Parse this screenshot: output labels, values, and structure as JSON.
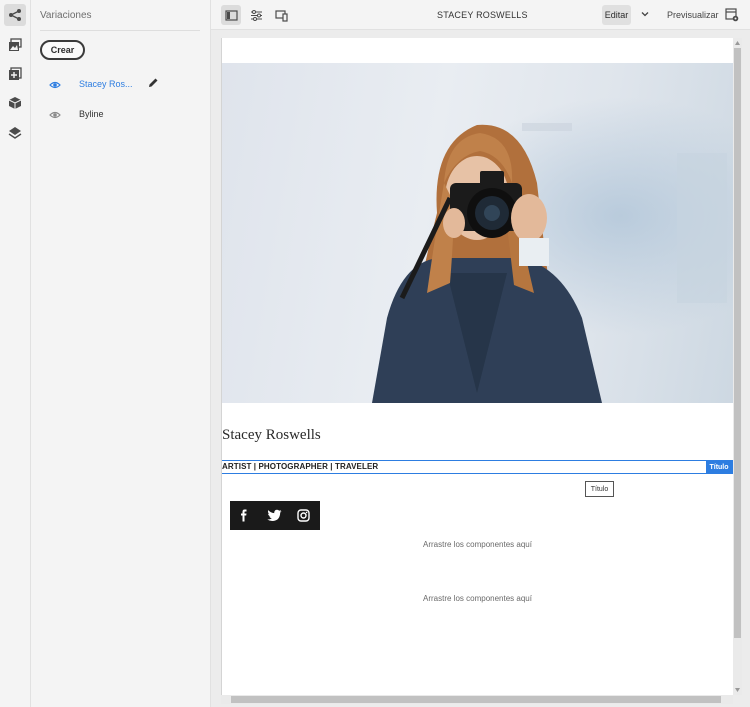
{
  "rail": {
    "items": [
      "share-variations-icon",
      "assets-icon",
      "add-component-icon",
      "content-fragment-icon",
      "layers-icon"
    ]
  },
  "panel": {
    "title": "Variaciones",
    "create_label": "Crear",
    "variations": [
      {
        "label": "Stacey Ros...",
        "active": true
      },
      {
        "label": "Byline",
        "active": false
      }
    ]
  },
  "topbar": {
    "doc_title": "STACEY ROSWELLS",
    "edit_label": "Editar",
    "preview_label": "Previsualizar"
  },
  "content": {
    "name": "Stacey Roswells",
    "subtitle": "ARTIST | PHOTOGRAPHER | TRAVELER",
    "component_tag": "Título",
    "tooltip": "Título",
    "drop_1": "Arrastre los componentes aquí",
    "drop_2": "Arrastre los componentes aquí",
    "social": [
      "facebook-icon",
      "twitter-icon",
      "instagram-icon"
    ]
  },
  "colors": {
    "accent": "#2d7de1",
    "active_link": "#2d7de1"
  }
}
